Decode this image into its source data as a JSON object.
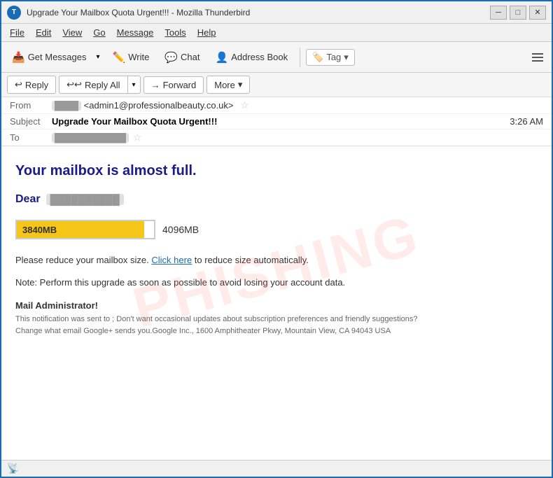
{
  "window": {
    "title": "Upgrade Your Mailbox Quota Urgent!!! - Mozilla Thunderbird",
    "logo_text": "T"
  },
  "title_controls": {
    "minimize_label": "─",
    "maximize_label": "□",
    "close_label": "✕"
  },
  "menu": {
    "items": [
      "File",
      "Edit",
      "View",
      "Go",
      "Message",
      "Tools",
      "Help"
    ]
  },
  "toolbar": {
    "get_messages_label": "Get Messages",
    "write_label": "Write",
    "chat_label": "Chat",
    "address_book_label": "Address Book",
    "tag_label": "Tag"
  },
  "email_actions": {
    "reply_label": "Reply",
    "reply_all_label": "Reply All",
    "forward_label": "Forward",
    "more_label": "More"
  },
  "email_meta": {
    "from_label": "From",
    "from_name_placeholder": "████",
    "from_email": "<admin1@professionalbeauty.co.uk>",
    "subject_label": "Subject",
    "subject_text": "Upgrade Your Mailbox Quota Urgent!!!",
    "time": "3:26 AM",
    "to_label": "To",
    "to_placeholder": "████████████"
  },
  "email_body": {
    "watermark": "PHISHING",
    "heading": "Your mailbox is almost full.",
    "dear_prefix": "Dear",
    "dear_name_placeholder": "██████████",
    "quota_used": "3840MB",
    "quota_total": "4096MB",
    "quota_percent": 93,
    "para1_before": "Please reduce your mailbox size. ",
    "para1_link": "Click here",
    "para1_after": " to reduce size automatically.",
    "note": "Note: Perform this upgrade as soon as possible to avoid  losing your account data.",
    "admin_title": "Mail Administrator!",
    "footer": "This notification was sent to ; Don't want occasional updates about subscription preferences and friendly suggestions?\nChange what email Google+ sends you.Google Inc., 1600 Amphitheater Pkwy, Mountain View, CA 94043 USA"
  },
  "status_bar": {
    "icon": "📡"
  }
}
